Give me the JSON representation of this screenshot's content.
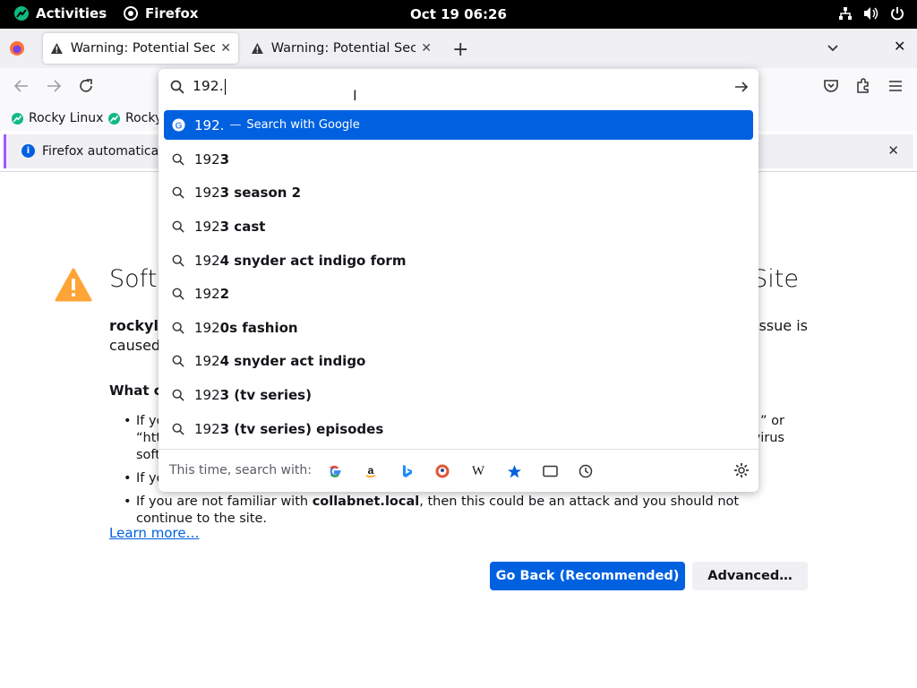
{
  "topbar": {
    "activities": "Activities",
    "app_name": "Firefox",
    "clock": "Oct 19  06:26"
  },
  "tabs": [
    {
      "title": "Warning: Potential Security Risk Ahead",
      "active": true
    },
    {
      "title": "Warning: Potential Security Risk Ahead",
      "active": false
    }
  ],
  "bookmarks": [
    {
      "label": "Rocky Linux"
    },
    {
      "label": "Rocky"
    }
  ],
  "notification": {
    "text": "Firefox automatically"
  },
  "page": {
    "title_left": "Softv",
    "title_right": "Site",
    "intro_line1_left": "rockyli",
    "intro_line1_right": "ssue is",
    "intro_line2": "caused",
    "what_heading": "What ca",
    "bullet1_left": "If yo",
    "bullet1_right": "” or",
    "bullet1_line2_left": "“htt",
    "bullet1_line2_right": "virus",
    "bullet1_line3": "soft",
    "bullet2": "If yo",
    "bullet3_pre": "If you are not familiar with ",
    "bullet3_bold": "collabnet.local",
    "bullet3_post": ", then this could be an attack and you should not continue to the site.",
    "learn_more": "Learn more…",
    "back_button": "Go Back (Recommended)",
    "advanced_button": "Advanced…"
  },
  "urlbar": {
    "value": "192.",
    "selected": {
      "text": "192.",
      "separator": "—",
      "action": "Search with Google"
    },
    "suggestions": [
      {
        "typed": "192",
        "rest": "3"
      },
      {
        "typed": "192",
        "rest": "3 season 2"
      },
      {
        "typed": "192",
        "rest": "3 cast"
      },
      {
        "typed": "192",
        "rest": "4 snyder act indigo form"
      },
      {
        "typed": "192",
        "rest": "2"
      },
      {
        "typed": "192",
        "rest": "0s fashion"
      },
      {
        "typed": "192",
        "rest": "4 snyder act indigo"
      },
      {
        "typed": "192",
        "rest": "3 (tv series)"
      },
      {
        "typed": "192",
        "rest": "3 (tv series) episodes"
      }
    ],
    "footer_label": "This time, search with:",
    "engines": [
      "google-icon",
      "amazon-icon",
      "bing-icon",
      "duckduckgo-icon",
      "wikipedia-icon",
      "bookmarks-icon",
      "tabs-icon",
      "history-icon"
    ]
  },
  "colors": {
    "accent": "#0061e0",
    "warning": "#ffa436",
    "notification_border": "#a259ff"
  }
}
